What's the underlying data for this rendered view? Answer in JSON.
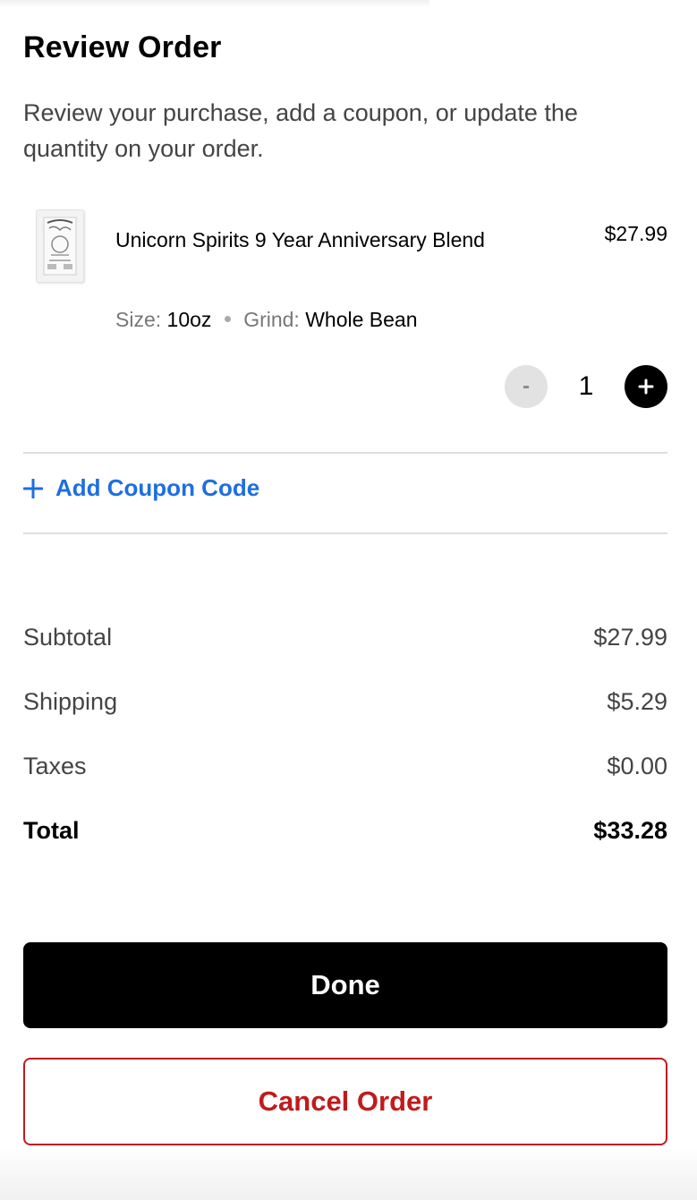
{
  "header": {
    "title": "Review Order",
    "subtitle": "Review your purchase, add a coupon, or update the quantity on your order."
  },
  "cart_item": {
    "name": "Unicorn Spirits 9 Year Anniversary Blend",
    "price": "$27.99",
    "size_label": "Size:",
    "size_value": "10oz",
    "grind_label": "Grind:",
    "grind_value": "Whole Bean",
    "quantity": "1",
    "decrement_label": "-",
    "thumbnail_icon": "coffee-bag-icon"
  },
  "coupon": {
    "label": "Add Coupon Code",
    "icon": "plus-icon",
    "color": "#1d6fe0"
  },
  "summary": {
    "subtotal_label": "Subtotal",
    "subtotal_value": "$27.99",
    "shipping_label": "Shipping",
    "shipping_value": "$5.29",
    "taxes_label": "Taxes",
    "taxes_value": "$0.00",
    "total_label": "Total",
    "total_value": "$33.28"
  },
  "actions": {
    "done_label": "Done",
    "cancel_label": "Cancel Order",
    "cancel_color": "#c01b1b"
  }
}
